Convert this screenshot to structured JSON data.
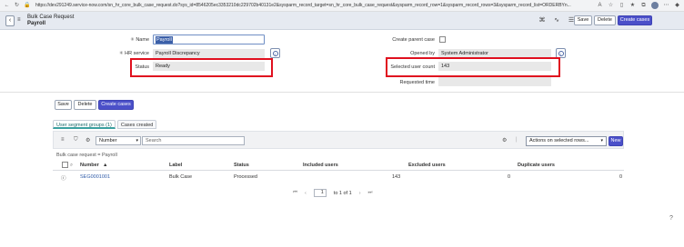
{
  "browser": {
    "url": "https://dev291249.service-now.com/sn_hr_core_bulk_case_request.do?sys_id=8546205ec3353210dc229702b40131e2&sysparm_record_target=sn_hr_core_bulk_case_request&sysparm_record_row=1&sysparm_record_rows=3&sysparm_record_list=ORDERBYn..."
  },
  "header": {
    "title": "Bulk Case Request",
    "subtitle": "Payroll",
    "save_label": "Save",
    "delete_label": "Delete",
    "create_cases_label": "Create cases"
  },
  "form": {
    "name_label": "Name",
    "name_value": "Payroll",
    "hr_service_label": "HR service",
    "hr_service_value": "Payroll Discrepancy",
    "status_label": "Status",
    "status_value": "Ready",
    "create_parent_case_label": "Create parent case",
    "opened_by_label": "Opened by",
    "opened_by_value": "System Administrator",
    "selected_user_count_label": "Selected user count",
    "selected_user_count_value": "143",
    "requested_time_label": "Requested time",
    "requested_time_value": ""
  },
  "form_buttons": {
    "save_label": "Save",
    "delete_label": "Delete",
    "create_cases_label": "Create cases"
  },
  "related": {
    "tabs": [
      {
        "label": "User segment groups (1)"
      },
      {
        "label": "Cases created"
      }
    ],
    "search_field_option": "Number",
    "search_placeholder": "Search",
    "actions_label": "Actions on selected rows...",
    "new_label": "New",
    "breadcrumb": "Bulk case request = Payroll",
    "columns": [
      "Number",
      "Label",
      "Status",
      "Included users",
      "Excluded users",
      "Duplicate users"
    ],
    "rows": [
      {
        "number": "SEG0001001",
        "label": "Bulk Case",
        "status": "Processed",
        "included": "143",
        "excluded": "0",
        "duplicate": "0"
      }
    ],
    "pager_value": "1",
    "pager_text": "to 1 of 1"
  },
  "colors": {
    "primary_button": "#4b50c9",
    "highlight": "#e0101f",
    "link": "#2e5aa8"
  }
}
